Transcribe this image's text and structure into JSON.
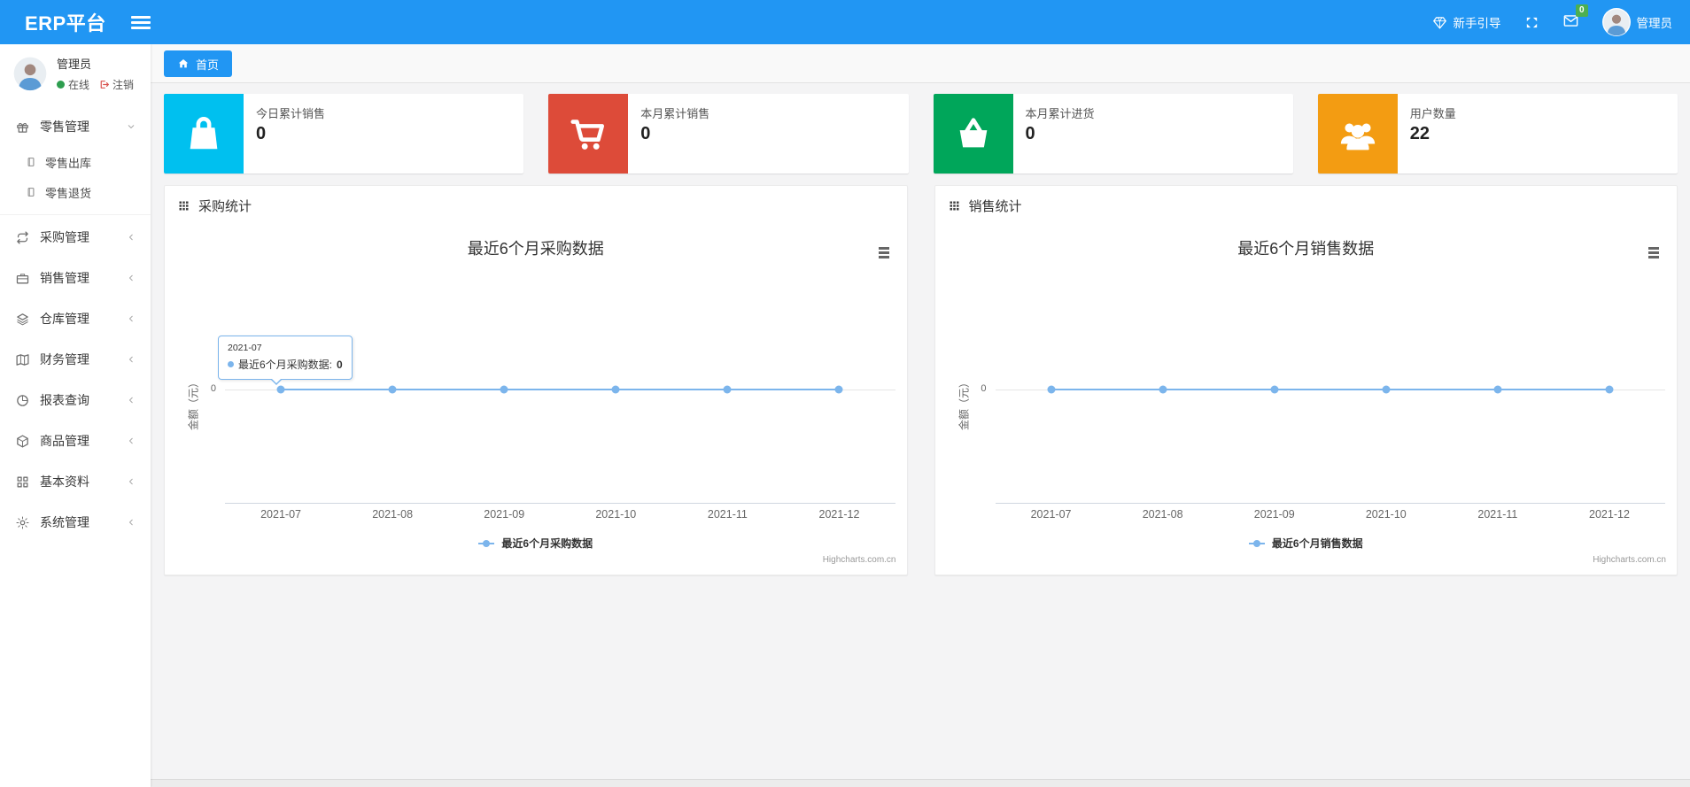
{
  "navbar": {
    "brand": "ERP平台",
    "menu_icon": "bars",
    "guide": {
      "icon": "gem",
      "label": "新手引导"
    },
    "fullscreen_icon": "expand",
    "mail": {
      "icon": "envelope",
      "badge": "0"
    },
    "user": {
      "avatar_icon": "avatar",
      "name": "管理员"
    }
  },
  "sidebar": {
    "user": {
      "avatar_icon": "avatar",
      "name": "管理员",
      "status_dot_color": "#2e9e4f",
      "status_label": "在线",
      "logout_icon": "sign-out",
      "logout_label": "注销"
    },
    "items": [
      {
        "key": "retail",
        "icon": "gift",
        "label": "零售管理",
        "chevron": "down",
        "expanded": true,
        "children": [
          {
            "key": "retail-outbound",
            "icon": "journal",
            "label": "零售出库"
          },
          {
            "key": "retail-return",
            "icon": "journal",
            "label": "零售退货"
          }
        ]
      },
      {
        "key": "purchase",
        "icon": "repeat",
        "label": "采购管理",
        "chevron": "left"
      },
      {
        "key": "sales",
        "icon": "briefcase",
        "label": "销售管理",
        "chevron": "left"
      },
      {
        "key": "warehouse",
        "icon": "layers",
        "label": "仓库管理",
        "chevron": "left"
      },
      {
        "key": "finance",
        "icon": "map-book",
        "label": "财务管理",
        "chevron": "left"
      },
      {
        "key": "report",
        "icon": "pie-chart",
        "label": "报表查询",
        "chevron": "left"
      },
      {
        "key": "goods",
        "icon": "cube",
        "label": "商品管理",
        "chevron": "left"
      },
      {
        "key": "basic",
        "icon": "grid",
        "label": "基本资料",
        "chevron": "left"
      },
      {
        "key": "system",
        "icon": "gear",
        "label": "系统管理",
        "chevron": "left"
      }
    ]
  },
  "tabbar": {
    "active_tab": {
      "icon": "home",
      "label": "首页"
    }
  },
  "cards": [
    {
      "key": "today-sales",
      "icon": "shopping-bag",
      "color": "#00C0EF",
      "label": "今日累计销售",
      "value": "0"
    },
    {
      "key": "month-sales",
      "icon": "shopping-cart",
      "color": "#DD4B39",
      "label": "本月累计销售",
      "value": "0"
    },
    {
      "key": "month-purchase",
      "icon": "basket",
      "color": "#00A65A",
      "label": "本月累计进货",
      "value": "0"
    },
    {
      "key": "user-count",
      "icon": "users",
      "color": "#F39C12",
      "label": "用户数量",
      "value": "22"
    }
  ],
  "panels": [
    {
      "key": "purchase-stats",
      "icon": "th",
      "title": "采购统计"
    },
    {
      "key": "sales-stats",
      "icon": "th",
      "title": "销售统计"
    }
  ],
  "chart_data": [
    {
      "type": "line",
      "title": "最近6个月采购数据",
      "categories": [
        "2021-07",
        "2021-08",
        "2021-09",
        "2021-10",
        "2021-11",
        "2021-12"
      ],
      "series": [
        {
          "name": "最近6个月采购数据",
          "values": [
            0,
            0,
            0,
            0,
            0,
            0
          ]
        }
      ],
      "xlabel": "",
      "ylabel": "金额（元）",
      "ytick_labels": [
        "0"
      ],
      "line_color": "#7CB5EC",
      "grid": true,
      "legend_position": "bottom",
      "credit": "Highcharts.com.cn",
      "tooltip": {
        "category": "2021-07",
        "series": "最近6个月采购数据",
        "value": "0"
      }
    },
    {
      "type": "line",
      "title": "最近6个月销售数据",
      "categories": [
        "2021-07",
        "2021-08",
        "2021-09",
        "2021-10",
        "2021-11",
        "2021-12"
      ],
      "series": [
        {
          "name": "最近6个月销售数据",
          "values": [
            0,
            0,
            0,
            0,
            0,
            0
          ]
        }
      ],
      "xlabel": "",
      "ylabel": "金额（元）",
      "ytick_labels": [
        "0"
      ],
      "line_color": "#7CB5EC",
      "grid": true,
      "legend_position": "bottom",
      "credit": "Highcharts.com.cn"
    }
  ]
}
